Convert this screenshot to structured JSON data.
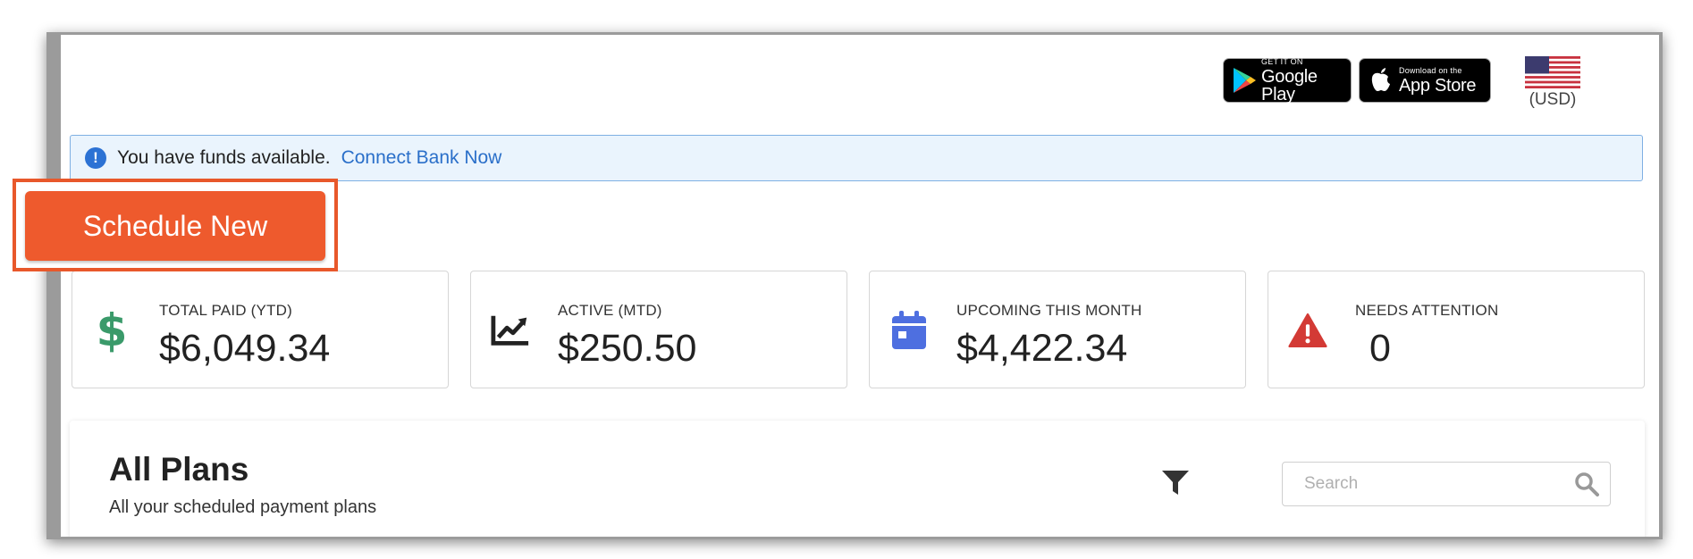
{
  "badges": {
    "google_small": "GET IT ON",
    "google_big": "Google Play",
    "apple_small": "Download on the",
    "apple_big": "App Store"
  },
  "currency": {
    "label": "(USD)",
    "flag_icon": "us-flag-icon"
  },
  "alert": {
    "message": "You have funds available.",
    "link": "Connect Bank Now"
  },
  "schedule_button": {
    "label": "Schedule New"
  },
  "cards": [
    {
      "label": "TOTAL PAID (YTD)",
      "value": "$6,049.34",
      "icon": "dollar-icon",
      "color": "#3a9a6a"
    },
    {
      "label": "ACTIVE (MTD)",
      "value": "$250.50",
      "icon": "trend-chart-icon",
      "color": "#222222"
    },
    {
      "label": "UPCOMING THIS MONTH",
      "value": "$4,422.34",
      "icon": "calendar-icon",
      "color": "#4e6fe0"
    },
    {
      "label": "NEEDS ATTENTION",
      "value": "0",
      "icon": "warning-icon",
      "color": "#d33a35"
    }
  ],
  "plans": {
    "title": "All Plans",
    "subtitle": "All your scheduled payment plans",
    "search_placeholder": "Search"
  },
  "colors": {
    "accent_orange": "#ee5a2d",
    "link_blue": "#2a6fc9",
    "alert_bg": "#eaf4fd"
  }
}
